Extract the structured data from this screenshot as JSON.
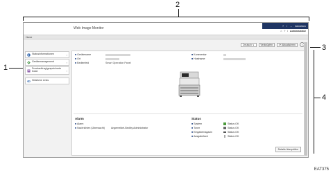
{
  "callouts": [
    "1",
    "2",
    "3",
    "4"
  ],
  "app": {
    "title": "Web Image Monitor",
    "top_icons": [
      "?",
      "i",
      "→"
    ],
    "logout_label": "Abmelden",
    "sub_icons": [
      "⌂",
      "?",
      "i"
    ],
    "user": "Administrator",
    "home_label": "Home"
  },
  "sidebar": {
    "items": [
      {
        "label": "Statusinformationen",
        "icon": "info-icon",
        "color": "#3a6cb0"
      },
      {
        "label": "Gerätemanagement",
        "icon": "device-management-icon",
        "color": "#3a8d3a"
      },
      {
        "label": "Druckauftrag/gespeicherte Datei",
        "icon": "print-job-icon",
        "color": "#8a5aa8"
      }
    ],
    "links_label": "Nützliche Links"
  },
  "toolbar": {
    "language": "Deutsch",
    "language_arrow": "∨",
    "shortcut_label": "Verknüpfen",
    "refresh_label": "Aktualisieren",
    "help_glyph": "?"
  },
  "device_info": {
    "model_label": "Gerätename",
    "location_label": "Ort",
    "mode_label": "Bedienfeld",
    "mode_value": "Smart Operation Panel",
    "comment_label": "Kommentar",
    "host_label": "Hostname"
  },
  "alarm": {
    "title": "Alarm",
    "items": [
      {
        "label": "Alarm",
        "value": ""
      },
      {
        "label": "Nachrichten (Überwacht)",
        "value": "Angemeldet-Bediby Administrator"
      }
    ]
  },
  "status": {
    "title": "Status",
    "items": [
      {
        "label": "System",
        "value": "Status OK"
      },
      {
        "label": "Toner",
        "value": "Status OK"
      },
      {
        "label": "Eingabemagazin",
        "value": "Status OK"
      },
      {
        "label": "Ausgabefach",
        "value": "Status OK"
      }
    ]
  },
  "details_button": "Details überprüfen",
  "caption": "EAT375"
}
